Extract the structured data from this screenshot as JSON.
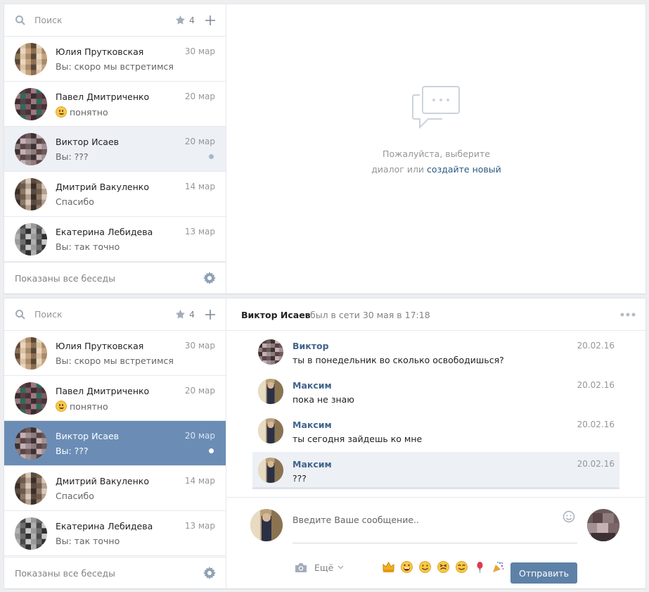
{
  "search": {
    "placeholder": "Поиск",
    "favorites_count": "4"
  },
  "dialogs": [
    {
      "name": "Юлия Прутковская",
      "date": "30 мар",
      "preview": "Вы: скоро мы встретимся",
      "emoji": false,
      "unread": false
    },
    {
      "name": "Павел Дмитриченко",
      "date": "20 мар",
      "preview": "понятно",
      "emoji": true,
      "unread": false
    },
    {
      "name": "Виктор Исаев",
      "date": "20 мар",
      "preview": "Вы: ???",
      "emoji": false,
      "unread": true
    },
    {
      "name": "Дмитрий Вакуленко",
      "date": "14 мар",
      "preview": "Спасибо",
      "emoji": false,
      "unread": false
    },
    {
      "name": "Екатерина Лебидева",
      "date": "13 мар",
      "preview": "Вы: так точно",
      "emoji": false,
      "unread": false
    }
  ],
  "footer": {
    "all_shown": "Показаны все беседы"
  },
  "empty_state": {
    "line1": "Пожалуйста, выберите",
    "line2_prefix": "диалог или",
    "line2_link": "создайте новый"
  },
  "chat": {
    "name": "Виктор Исаев",
    "status": "был в сети 30 мая в 17:18",
    "messages": [
      {
        "author": "Виктор",
        "date": "20.02.16",
        "text": "ты в понедельник во сколько освободишься?"
      },
      {
        "author": "Максим",
        "date": "20.02.16",
        "text": "пока не знаю"
      },
      {
        "author": "Максим",
        "date": "20.02.16",
        "text": "ты сегодня зайдешь ко мне"
      },
      {
        "author": "Максим",
        "date": "20.02.16",
        "text": "???"
      }
    ]
  },
  "compose": {
    "placeholder": "Введите Ваше сообщение..",
    "more_label": "Ещё",
    "send_label": "Отправить",
    "emoji_names": [
      "crown-emoji",
      "grinning-emoji",
      "smiling-emoji",
      "squinting-emoji",
      "blush-emoji",
      "balloon-emoji",
      "party-popper-emoji"
    ]
  },
  "colors": {
    "accent": "#5e81a8",
    "active_row": "#6b8db5",
    "selected_row": "#edf0f5",
    "link": "#2a5885",
    "author": "#42648b"
  }
}
